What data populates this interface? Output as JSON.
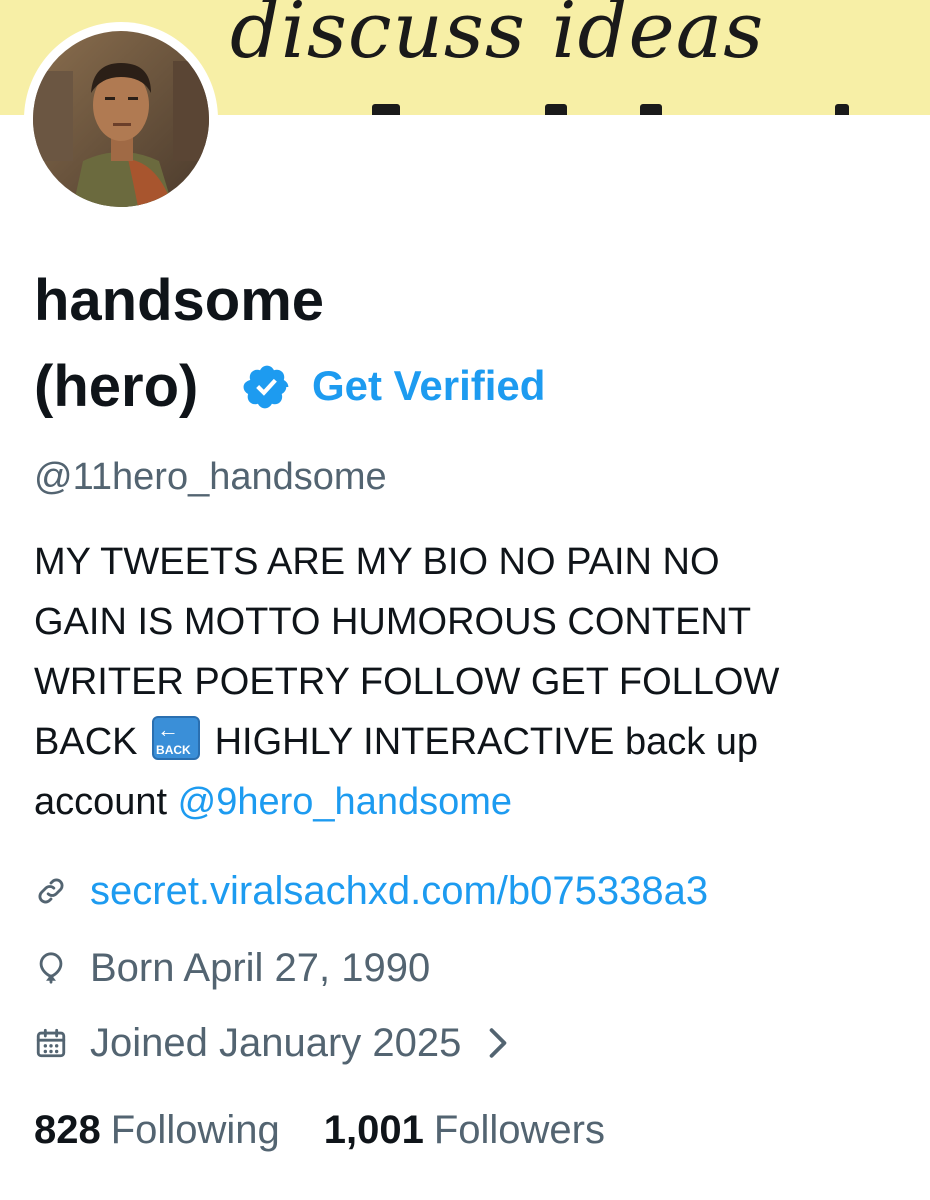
{
  "banner": {
    "text": "discuss ideas",
    "background": "#f7efa6"
  },
  "profile": {
    "name_line1": "handsome",
    "name_line2": "(hero)",
    "get_verified_label": "Get Verified",
    "handle": "@11hero_handsome",
    "bio": {
      "line1": "MY TWEETS ARE MY BIO NO PAIN NO",
      "line2": "GAIN IS MOTTO HUMOROUS CONTENT",
      "line3": "WRITER POETRY  FOLLOW GET FOLLOW",
      "line4_pre": "BACK ",
      "line4_emoji": "BACK",
      "line4_post": " HIGHLY INTERACTIVE back up",
      "line5_pre": "account ",
      "line5_mention": "@9hero_handsome"
    },
    "website": "secret.viralsachxd.com/b075338a3",
    "birthday": "Born April 27, 1990",
    "joined": "Joined January 2025",
    "following_count": "828",
    "following_label": "Following",
    "followers_count": "1,001",
    "followers_label": "Followers"
  },
  "icons": {
    "verified": "verified-badge-icon",
    "link": "link-icon",
    "birthday": "balloon-icon",
    "calendar": "calendar-icon",
    "chevron": "chevron-right-icon"
  },
  "colors": {
    "accent": "#1d9bf0",
    "text": "#0f1419",
    "secondary": "#536471"
  }
}
